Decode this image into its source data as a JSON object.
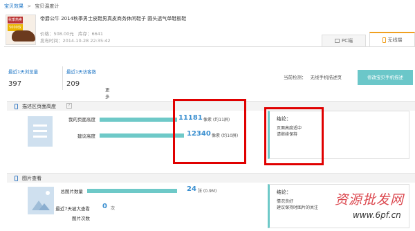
{
  "breadcrumb": {
    "root": "宝贝效果",
    "separator": ">",
    "current": "宝贝温度计"
  },
  "product": {
    "thumb_label1": "秋季热卖",
    "thumb_label2": "5000双",
    "title": "帝爵公牛 2014秋季男士皮鞋男真皮商务休闲鞋子 圆头透气单鞋板鞋",
    "price_label": "价格：",
    "price": "508.00元",
    "stock_label": "库存：",
    "stock": "6641",
    "published_label": "发布时间：",
    "published": "2014-10-28 22:35:42"
  },
  "tabs": {
    "pc": "PC端",
    "mobile": "无线端"
  },
  "stats": [
    {
      "label": "最近1天浏览量",
      "value": "397"
    },
    {
      "label": "最近1天访客数",
      "value": "209"
    }
  ],
  "more_link": "更多>>",
  "detection": {
    "label": "当前检测：",
    "value": "无线手机描述页"
  },
  "edit_button": "修改宝贝手机描述",
  "page_height": {
    "title": "描述区页面高度",
    "rows": [
      {
        "label": "我的页面高度",
        "value": "11181",
        "unit": "像素 (约11屏)",
        "fraction": 0.62
      },
      {
        "label": "建议高度",
        "value": "12340",
        "unit": "像素 (约10屏)",
        "fraction": 0.68
      }
    ],
    "conclusion_title": "结论：",
    "conclusion_lines": [
      "页面高度适中",
      "请继续保持"
    ]
  },
  "image_check": {
    "title": "图片查看",
    "total_label": "总图片数量",
    "total_value": "24",
    "total_unit": "张 (0.9M)",
    "total_fraction": 0.65,
    "max_label_1": "最近7天被大查看",
    "max_label_2": "图片次数",
    "max_value": "0",
    "max_unit": "次",
    "conclusion_title": "结论：",
    "conclusion_lines": [
      "情况良好",
      "建议保持时图片的关注"
    ]
  },
  "watermark": {
    "cn": "资源批发网",
    "url": "www.6pf.cn"
  },
  "colors": {
    "accent_teal": "#6ec9c8",
    "link_blue": "#1a73c4",
    "highlight_red": "#e00000",
    "tab_orange": "#f0a020"
  }
}
